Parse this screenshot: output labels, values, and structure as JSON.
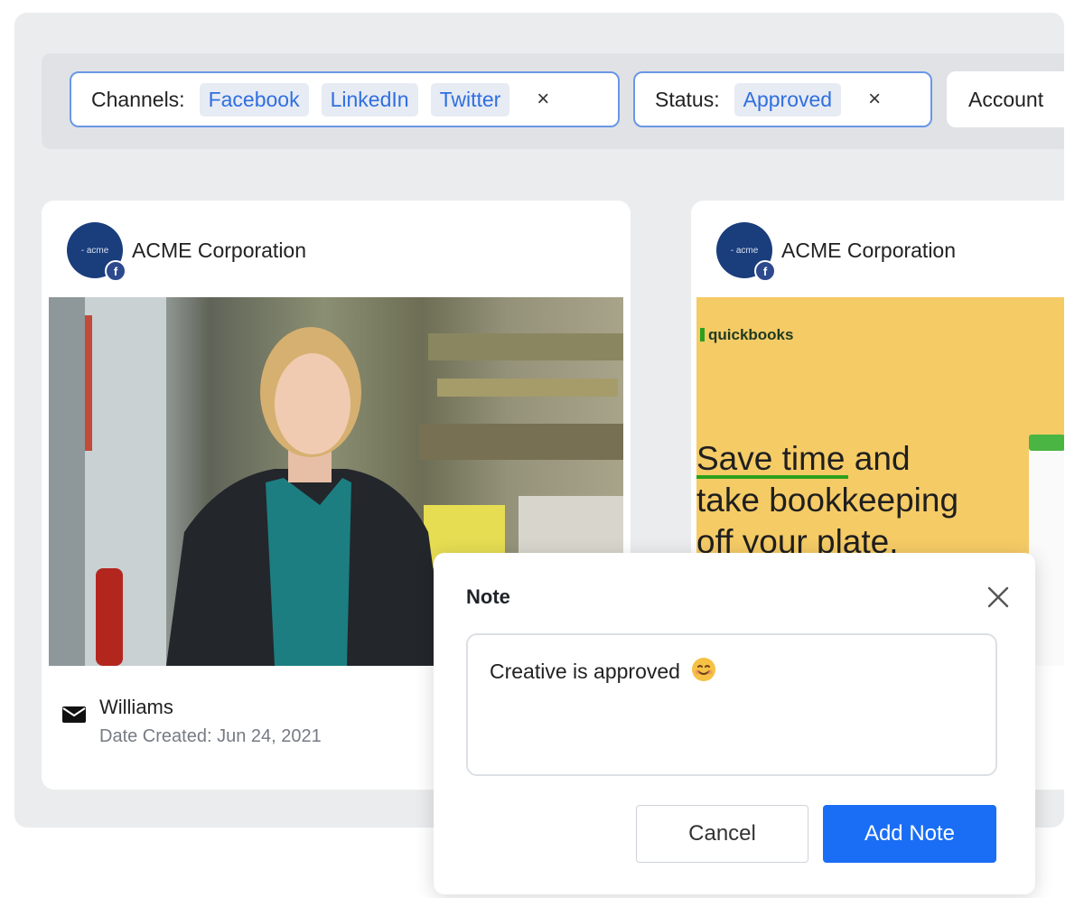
{
  "filters": {
    "channels": {
      "label": "Channels:",
      "tags": [
        "Facebook",
        "LinkedIn",
        "Twitter"
      ],
      "close": "×"
    },
    "status": {
      "label": "Status:",
      "tags": [
        "Approved"
      ],
      "close": "×"
    },
    "account": {
      "label": "Account"
    }
  },
  "cards": [
    {
      "account_name": "ACME Corporation",
      "avatar_text": "- acme",
      "network_badge": "f",
      "author_name": "Williams",
      "date_created": "Date Created: Jun 24, 2021"
    },
    {
      "account_name": "ACME Corporation",
      "avatar_text": "- acme",
      "network_badge": "f",
      "ad": {
        "brand": "quickbooks",
        "headline_line1_highlight": "Save time",
        "headline_line1_rest": " and",
        "headline_line2": "take bookkeeping",
        "headline_line3": "off your plate."
      }
    }
  ],
  "dialog": {
    "title": "Note",
    "note_text": "Creative is approved",
    "cancel_label": "Cancel",
    "submit_label": "Add Note"
  },
  "colors": {
    "accent": "#1a6ef5",
    "tag_text": "#2f6fe0",
    "chip_border": "#6a97e6",
    "ad_background": "#f5cb66",
    "ad_brand_green": "#2ca01c"
  }
}
